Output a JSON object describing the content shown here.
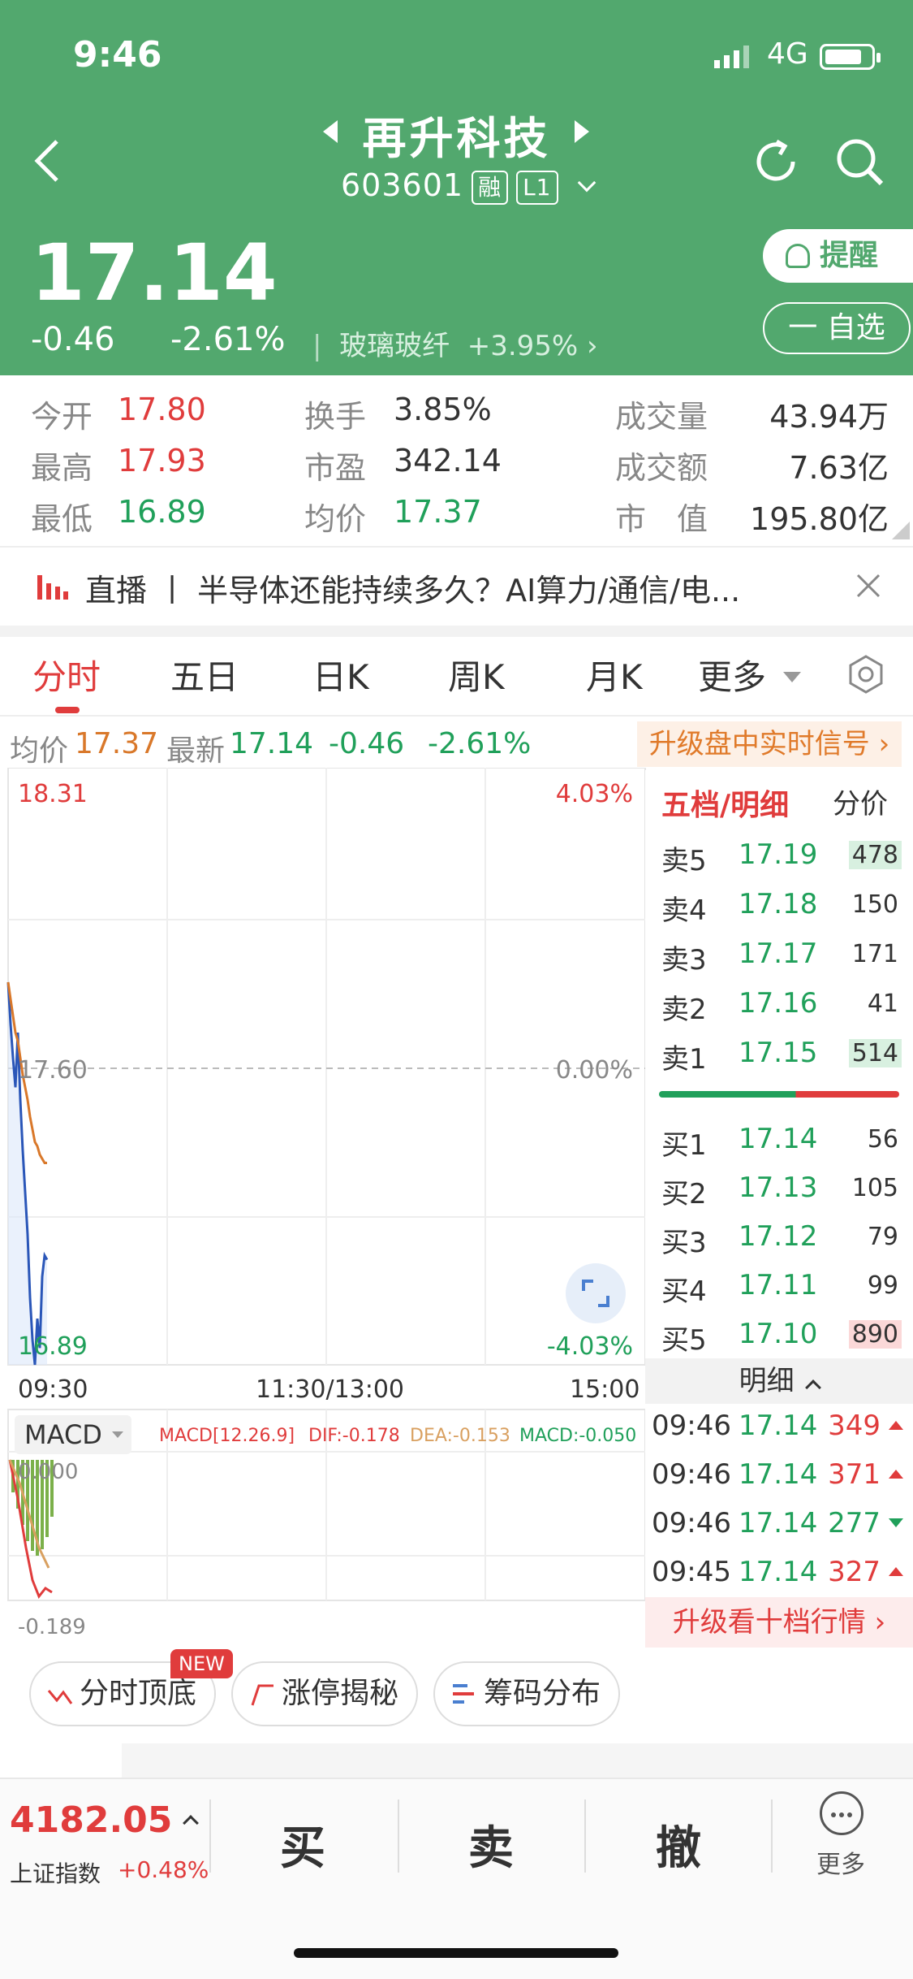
{
  "status_bar": {
    "time": "9:46",
    "network": "4G"
  },
  "header": {
    "stock_name": "再升科技",
    "code": "603601",
    "tag_margin": "融",
    "tag_level": "L1",
    "price": "17.14",
    "change": "-0.46",
    "change_pct": "-2.61%",
    "industry": "玻璃玻纤",
    "industry_change": "+3.95%",
    "remind_label": "提醒",
    "add_fav_label": "一 自选"
  },
  "stats": {
    "open_label": "今开",
    "open": "17.80",
    "high_label": "最高",
    "high": "17.93",
    "low_label": "最低",
    "low": "16.89",
    "turnover_label": "换手",
    "turnover": "3.85%",
    "pe_label": "市盈",
    "pe": "342.14",
    "avg_label": "均价",
    "avg": "17.37",
    "volume_label": "成交量",
    "volume": "43.94万",
    "amount_label": "成交额",
    "amount": "7.63亿",
    "mcap_label": "市　值",
    "mcap": "195.80亿"
  },
  "banner": {
    "text": "直播 丨 半导体还能持续多久？AI算力/通信/电..."
  },
  "tabs": [
    "分时",
    "五日",
    "日K",
    "周K",
    "月K",
    "更多"
  ],
  "info": {
    "avg_label": "均价",
    "avg": "17.37",
    "latest_label": "最新",
    "latest": "17.14",
    "chg": "-0.46",
    "chg_pct": "-2.61%",
    "upgrade": "升级盘中实时信号"
  },
  "chart": {
    "y_top": "18.31",
    "y_mid": "17.60",
    "y_bot": "16.89",
    "pct_top": "4.03%",
    "pct_mid": "0.00%",
    "pct_bot": "-4.03%",
    "x_start": "09:30",
    "x_mid": "11:30/13:00",
    "x_end": "15:00",
    "macd_label": "MACD",
    "macd_params": "MACD[12.26.9]",
    "dif": "DIF:-0.178",
    "dea": "DEA:-0.153",
    "macd": "MACD:-0.050",
    "macd_top": "0.000",
    "macd_bot": "-0.189"
  },
  "chart_data": {
    "type": "line",
    "x": [
      "09:30",
      "09:31",
      "09:32",
      "09:33",
      "09:34",
      "09:35",
      "09:36",
      "09:37",
      "09:38",
      "09:39",
      "09:40",
      "09:41",
      "09:42",
      "09:43",
      "09:44",
      "09:45",
      "09:46"
    ],
    "series": [
      {
        "values": [
          17.8,
          17.7,
          17.62,
          17.55,
          17.68,
          17.52,
          17.4,
          17.3,
          17.2,
          17.05,
          16.95,
          16.89,
          17.0,
          16.93,
          17.1,
          17.15,
          17.14
        ]
      },
      {
        "values": [
          17.8,
          17.76,
          17.72,
          17.68,
          17.66,
          17.62,
          17.58,
          17.55,
          17.52,
          17.48,
          17.45,
          17.42,
          17.41,
          17.39,
          17.38,
          17.37,
          17.37
        ]
      }
    ],
    "ylim": [
      16.89,
      18.31
    ]
  },
  "orderbook": {
    "title": "五档/明细",
    "subtitle": "分价",
    "sells": [
      {
        "label": "卖5",
        "price": "17.19",
        "vol": "478"
      },
      {
        "label": "卖4",
        "price": "17.18",
        "vol": "150"
      },
      {
        "label": "卖3",
        "price": "17.17",
        "vol": "171"
      },
      {
        "label": "卖2",
        "price": "17.16",
        "vol": "41"
      },
      {
        "label": "卖1",
        "price": "17.15",
        "vol": "514"
      }
    ],
    "buys": [
      {
        "label": "买1",
        "price": "17.14",
        "vol": "56"
      },
      {
        "label": "买2",
        "price": "17.13",
        "vol": "105"
      },
      {
        "label": "买3",
        "price": "17.12",
        "vol": "79"
      },
      {
        "label": "买4",
        "price": "17.11",
        "vol": "99"
      },
      {
        "label": "买5",
        "price": "17.10",
        "vol": "890"
      }
    ],
    "detail_label": "明细",
    "details": [
      {
        "time": "09:46",
        "price": "17.14",
        "vol": "349"
      },
      {
        "time": "09:46",
        "price": "17.14",
        "vol": "371"
      },
      {
        "time": "09:46",
        "price": "17.14",
        "vol": "277"
      },
      {
        "time": "09:45",
        "price": "17.14",
        "vol": "327"
      }
    ],
    "upgrade": "升级看十档行情"
  },
  "features": {
    "f1": "分时顶底",
    "f1_badge": "NEW",
    "f2": "涨停揭秘",
    "f3": "筹码分布"
  },
  "bottom": {
    "index_value": "4182.05",
    "index_name": "上证指数",
    "index_chg": "+0.48%",
    "buy": "买",
    "sell": "卖",
    "cancel": "撤",
    "more": "更多"
  }
}
